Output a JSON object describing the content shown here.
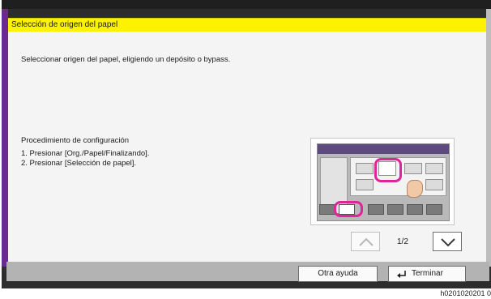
{
  "window": {
    "title": "Selección de origen del papel"
  },
  "description": "Seleccionar origen del papel, eligiendo un depósito o bypass.",
  "procedure": {
    "title": "Procedimiento de configuración",
    "steps": [
      "1. Presionar [Org./Papel/Finalizando].",
      "2. Presionar [Selección de papel]."
    ]
  },
  "pager": {
    "indicator": "1/2",
    "up_icon": "chevron-up-icon",
    "down_icon": "chevron-down-icon"
  },
  "buttons": {
    "help_label": "Otra ayuda",
    "finish_label": "Terminar",
    "finish_icon": "return-arrow-icon"
  },
  "image_code": "h0201020201 0",
  "colors": {
    "title_bar": "#fff200",
    "side_accent": "#6a2a8f",
    "highlight_ring": "#e0249a",
    "background": "#f4f4f4"
  }
}
